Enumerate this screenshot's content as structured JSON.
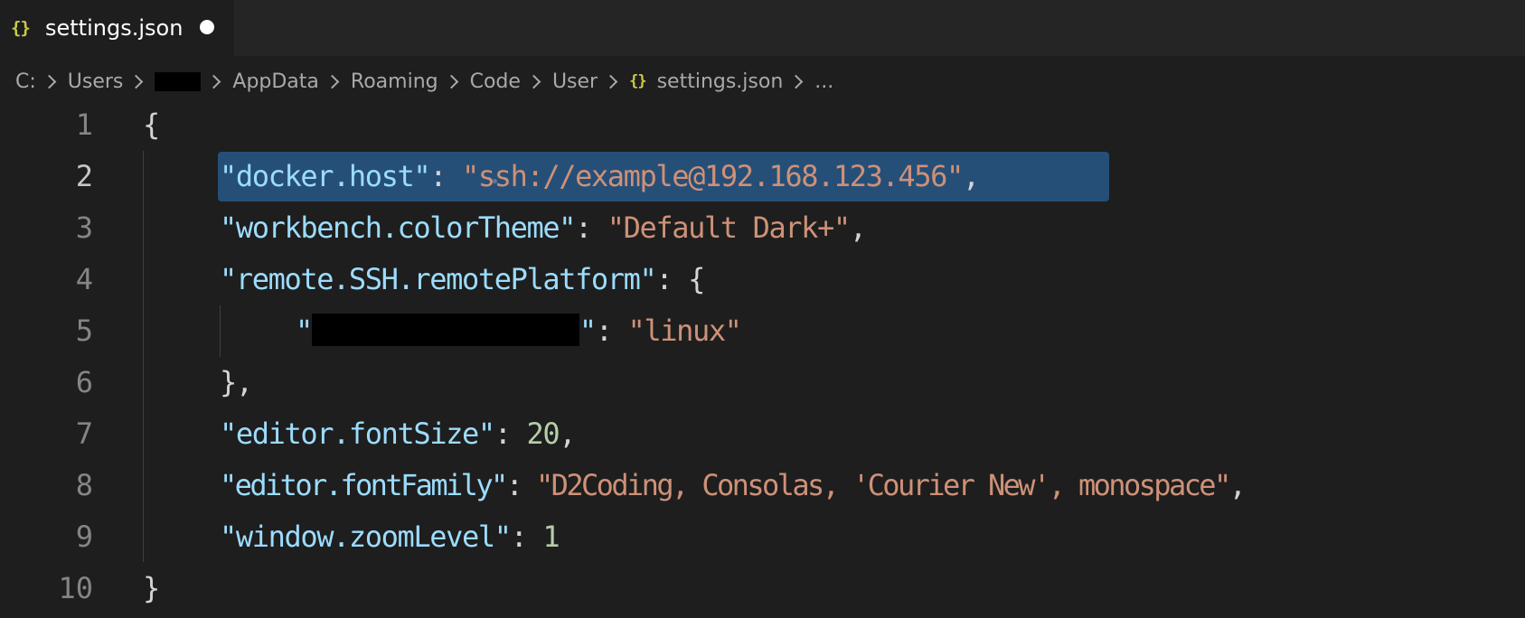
{
  "tab": {
    "icon": "{}",
    "icon_name": "json-braces-icon",
    "label": "settings.json",
    "dirty": true
  },
  "breadcrumb": {
    "items": [
      "C:",
      "Users",
      "",
      "AppData",
      "Roaming",
      "Code",
      "User",
      "settings.json",
      "..."
    ]
  },
  "editor": {
    "active_line": 2,
    "lines": [
      {
        "n": "1",
        "tokens": {
          "p1": "{"
        }
      },
      {
        "n": "2",
        "tokens": {
          "key": "\"docker.host\"",
          "colon": ":",
          "val": "\"ssh://example@192.168.123.456\"",
          "comma": ","
        }
      },
      {
        "n": "3",
        "tokens": {
          "key": "\"workbench.colorTheme\"",
          "colon": ": ",
          "val": "\"Default Dark+\"",
          "comma": ","
        }
      },
      {
        "n": "4",
        "tokens": {
          "key": "\"remote.SSH.remotePlatform\"",
          "colon": ": ",
          "p1": "{"
        }
      },
      {
        "n": "5",
        "tokens": {
          "q1": "\"",
          "q2": "\"",
          "colon": ": ",
          "val": "\"linux\""
        }
      },
      {
        "n": "6",
        "tokens": {
          "p1": "},"
        }
      },
      {
        "n": "7",
        "tokens": {
          "key": "\"editor.fontSize\"",
          "colon": ": ",
          "num": "20",
          "comma": ","
        }
      },
      {
        "n": "8",
        "tokens": {
          "key": "\"editor.fontFamily\"",
          "colon": ": ",
          "val": "\"D2Coding, Consolas, 'Courier New', monospace\"",
          "comma": ","
        }
      },
      {
        "n": "9",
        "tokens": {
          "key": "\"window.zoomLevel\"",
          "colon": ": ",
          "num": "1"
        }
      },
      {
        "n": "10",
        "tokens": {
          "p1": "}"
        }
      }
    ]
  }
}
